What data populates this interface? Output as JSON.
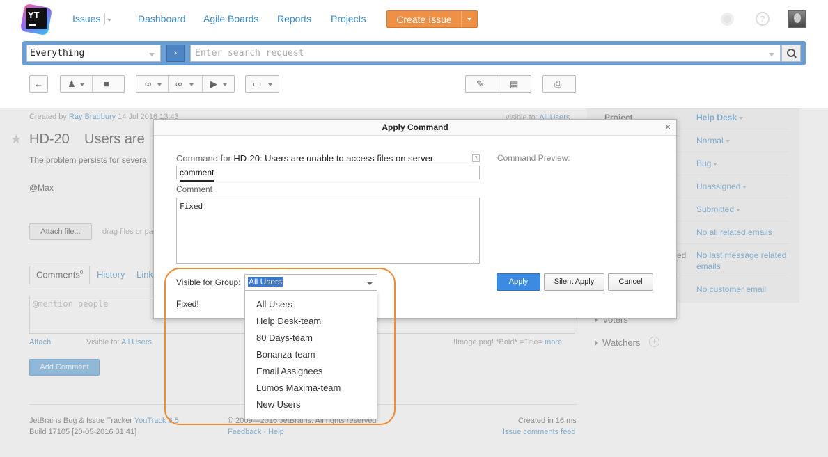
{
  "logo": {
    "text": "YT"
  },
  "nav": {
    "issues": "Issues",
    "dashboard": "Dashboard",
    "agile": "Agile Boards",
    "reports": "Reports",
    "projects": "Projects",
    "create": "Create Issue"
  },
  "search": {
    "context": "Everything",
    "go": "›",
    "placeholder": "Enter search request"
  },
  "issue": {
    "created_prefix": "Created by",
    "author": "Ray Bradbury",
    "date": "14 Jul 2016 13:43",
    "visible_prefix": "visible to:",
    "visible_value": "All Users",
    "id": "HD-20",
    "title": "Users are",
    "description": "The problem persists for severa",
    "mention": "@Max",
    "attach": "Attach file...",
    "drag_hint": "drag files or pa"
  },
  "tabs": {
    "comments": "Comments",
    "comments_count": "0",
    "history": "History",
    "links": "Link"
  },
  "comment_box": {
    "placeholder": "@mention people",
    "attach": "Attach",
    "visible_prefix": "Visible to:",
    "visible_value": "All Users",
    "format_hint": "!Image.png!   *Bold*   =Title=",
    "more": "more",
    "add": "Add Comment"
  },
  "footer": {
    "tracker": "JetBrains Bug & Issue Tracker",
    "product": "YouTrack 6.5",
    "build": "Build 17105 [20-05-2016 01:41]",
    "copyright": "© 2009—2016 JetBrains. All rights reserved",
    "feedback": "Feedback",
    "help": "Help",
    "created_in": "Created in 16 ms",
    "feed": "Issue comments feed"
  },
  "right_panel": {
    "project_label": "Project",
    "project": "Help Desk",
    "priority": "Normal",
    "type": "Bug",
    "assignee": "Unassigned",
    "state": "Submitted",
    "related_emails": "No all related emails",
    "last_message_label_tail": "ed",
    "last_message_1": "No last message related",
    "last_message_2": "emails",
    "customer_email": "No customer email",
    "voters": "Voters",
    "watchers": "Watchers"
  },
  "dialog": {
    "title": "Apply Command",
    "close": "×",
    "command_for": "Command for",
    "command_issue": "HD-20: Users are unable to access files on server",
    "command_value": "comment",
    "comment_label": "Comment",
    "comment_text": "Fixed!",
    "preview_label": "Command Preview:",
    "visible_label": "Visible for Group:",
    "visible_value": "All Users",
    "preview_text": "Fixed!",
    "apply": "Apply",
    "silent_apply": "Silent Apply",
    "cancel": "Cancel"
  },
  "dropdown": {
    "options": [
      "All Users",
      "Help Desk-team",
      "80 Days-team",
      "Bonanza-team",
      "Email Assignees",
      "Lumos Maxima-team",
      "New Users"
    ]
  }
}
